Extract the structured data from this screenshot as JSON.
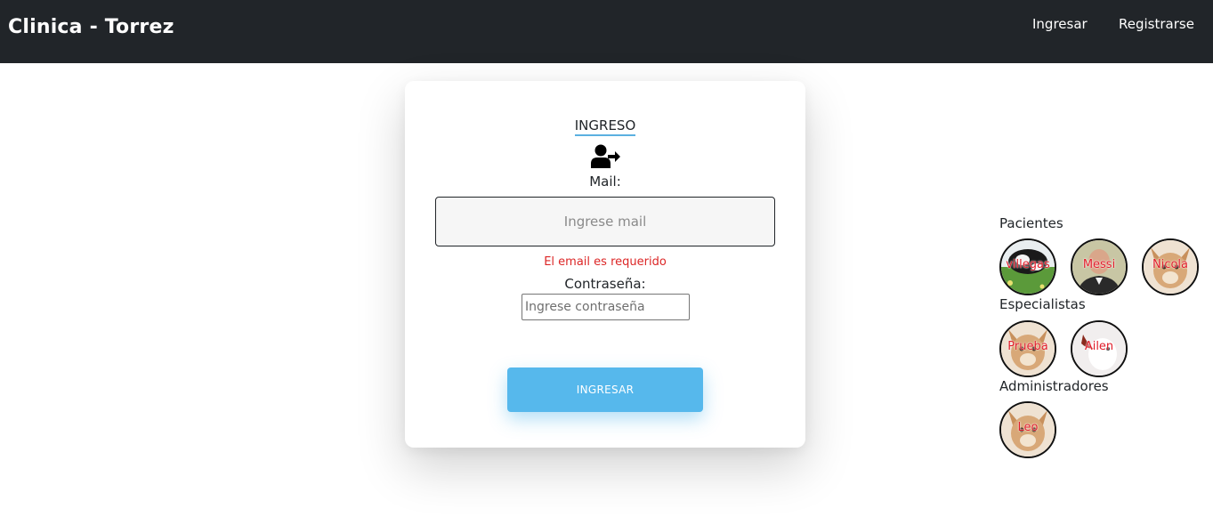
{
  "header": {
    "brand": "Clinica - Torrez",
    "nav": {
      "login_label": "Ingresar",
      "register_label": "Registrarse"
    }
  },
  "login_card": {
    "title": "INGRESO",
    "icon": "user-arrow-right-icon",
    "mail_label": "Mail:",
    "mail_placeholder": "Ingrese mail",
    "mail_value": "",
    "mail_error": "El email es requerido",
    "password_label": "Contraseña:",
    "password_placeholder": "Ingrese contraseña",
    "password_value": "",
    "submit_label": "INGRESAR"
  },
  "quick_access": {
    "patients": {
      "heading": "Pacientes",
      "users": [
        {
          "name": "villegas",
          "photo": "cow-in-grass"
        },
        {
          "name": "Messi",
          "photo": "man-in-suit"
        },
        {
          "name": "Nicola",
          "photo": "chihuahua"
        }
      ]
    },
    "specialists": {
      "heading": "Especialistas",
      "users": [
        {
          "name": "Prueba",
          "photo": "chihuahua"
        },
        {
          "name": "Ailen",
          "photo": "white-animal"
        }
      ]
    },
    "admins": {
      "heading": "Administradores",
      "users": [
        {
          "name": "Leo",
          "photo": "chihuahua"
        }
      ]
    }
  },
  "colors": {
    "navbar_bg": "#212529",
    "accent": "#56b8ec",
    "error": "#dc2626",
    "avatar_label": "#e11d2a"
  }
}
